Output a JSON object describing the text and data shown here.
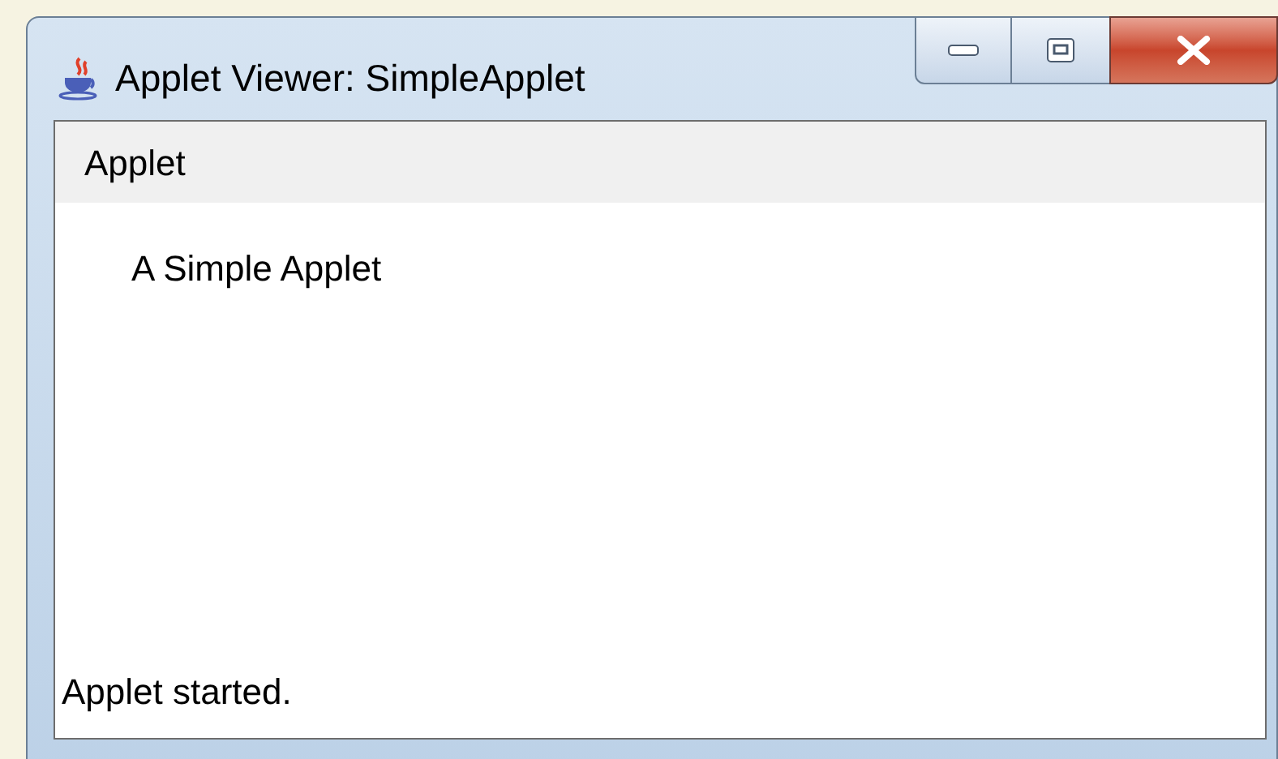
{
  "window": {
    "title": "Applet Viewer: SimpleApplet"
  },
  "menu_bar": {
    "items": [
      "Applet"
    ]
  },
  "applet": {
    "text": "A Simple Applet"
  },
  "status_bar": {
    "text": "Applet started."
  }
}
